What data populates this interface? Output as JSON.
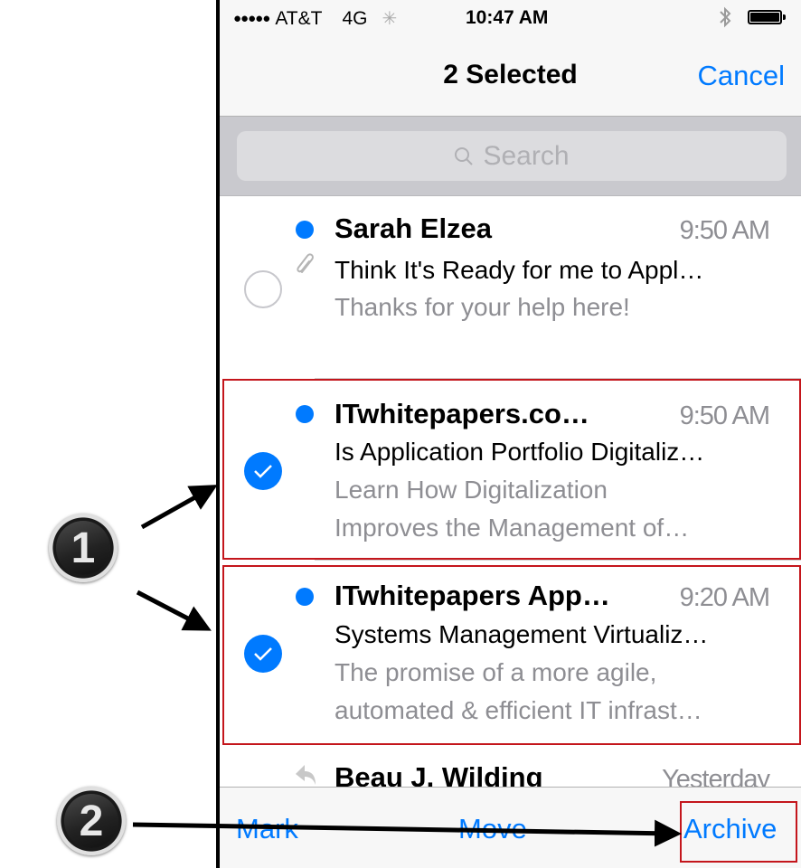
{
  "status_bar": {
    "signal": "●●●●●",
    "carrier": "AT&T",
    "network": "4G",
    "activity_icon": "loading-spinner-icon",
    "time": "10:47 AM",
    "bluetooth_icon": "bluetooth-icon",
    "battery_icon": "battery-full-icon",
    "battery_level": "100%"
  },
  "nav": {
    "title": "2 Selected",
    "cancel_label": "Cancel"
  },
  "search": {
    "placeholder": "Search"
  },
  "messages": [
    {
      "sender": "Sarah Elzea",
      "time": "9:50 AM",
      "subject": "Think It's Ready for me to Appl…",
      "preview": [
        "Thanks for your help here!"
      ],
      "unread": true,
      "attachment": true,
      "selected": false
    },
    {
      "sender": "ITwhitepapers.co…",
      "time": "9:50 AM",
      "subject": "Is Application Portfolio Digitaliz…",
      "preview": [
        "Learn How Digitalization",
        "Improves the Management of…"
      ],
      "unread": true,
      "attachment": false,
      "selected": true
    },
    {
      "sender": "ITwhitepapers App…",
      "time": "9:20 AM",
      "subject": "Systems Management Virtualiz…",
      "preview": [
        "The promise of a more agile,",
        "automated & efficient IT infrast…"
      ],
      "unread": true,
      "attachment": false,
      "selected": true
    },
    {
      "sender": "Beau J. Wilding",
      "time": "Yesterday",
      "replied": true
    }
  ],
  "toolbar": {
    "mark_label": "Mark",
    "move_label": "Move",
    "archive_label": "Archive"
  },
  "annotations": {
    "step1_label": "1",
    "step2_label": "2",
    "highlight_color": "#c4161c"
  },
  "colors": {
    "accent": "#007aff",
    "secondary_text": "#8e8e93"
  }
}
